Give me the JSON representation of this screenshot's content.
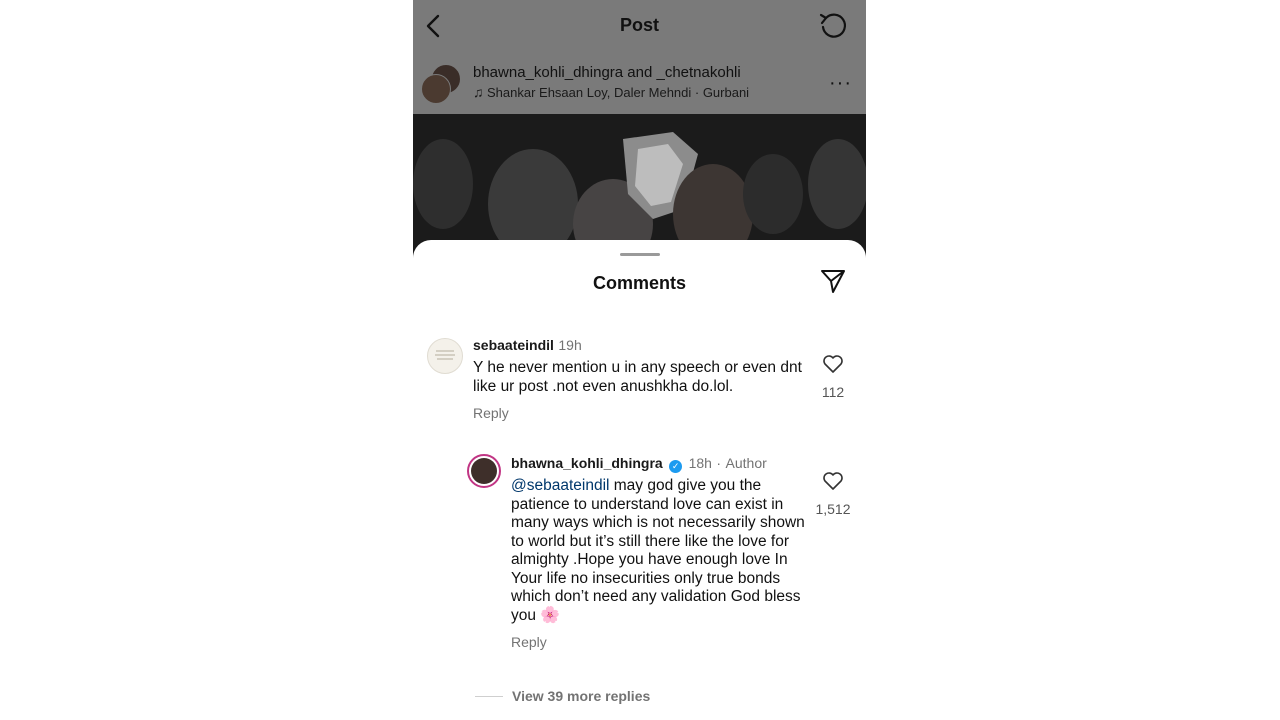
{
  "header": {
    "title": "Post"
  },
  "post": {
    "users": "bhawna_kohli_dhingra and _chetnakohli",
    "music": "Shankar Ehsaan Loy, Daler Mehndi · Gurbani",
    "more": "···"
  },
  "comments_sheet": {
    "title": "Comments",
    "comments": [
      {
        "username": "sebaateindil",
        "time": "19h",
        "text": "Y he never mention u in any speech or even dnt like ur post .not even anushkha do.lol.",
        "reply_label": "Reply",
        "likes": "112"
      },
      {
        "username": "bhawna_kohli_dhingra",
        "verified": "✓",
        "time": "18h",
        "separator": "·",
        "author_badge": "Author",
        "mention": "@sebaateindil",
        "text": " may god give you the patience to understand love can exist in many ways which is not necessarily shown to world but it’s still there like the love for almighty .Hope  you have enough love In Your life no insecurities only true bonds which don’t need any validation God bless you ",
        "emoji": "🌸",
        "reply_label": "Reply",
        "likes": "1,512"
      }
    ],
    "view_more": "View 39 more replies"
  },
  "colors": {
    "mention": "#00376b",
    "ring": "#c13584",
    "verified": "#1d9bf0",
    "overlay": "#7a7a7a"
  },
  "icons": [
    "back-arrow-icon",
    "refresh-icon",
    "more-icon",
    "music-note-icon",
    "share-icon",
    "heart-icon",
    "verified-icon",
    "flower-emoji-icon"
  ]
}
